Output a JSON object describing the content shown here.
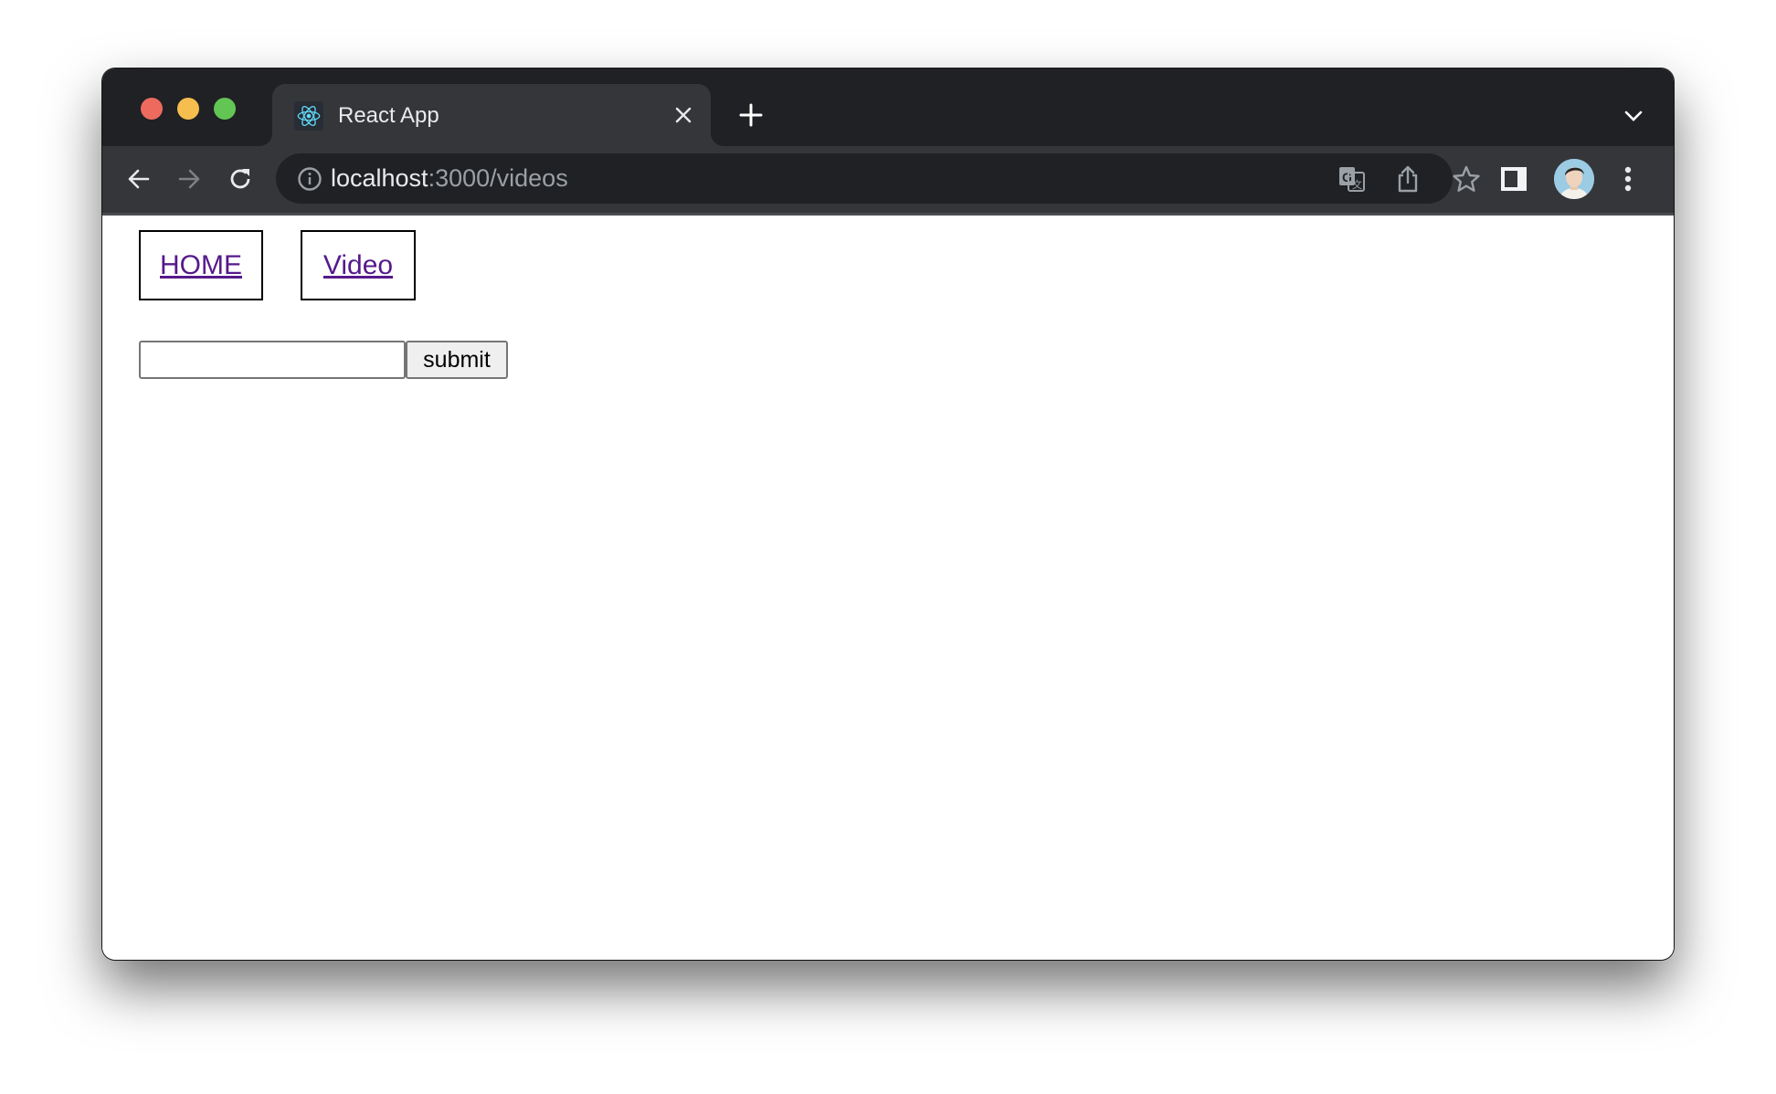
{
  "browser": {
    "tab": {
      "title": "React App",
      "favicon": "react-logo-icon"
    },
    "address_bar": {
      "host": "localhost",
      "path": ":3000/videos"
    },
    "icons": {
      "back": "arrow-left-icon",
      "forward": "arrow-right-icon",
      "reload": "reload-icon",
      "info": "info-icon",
      "translate": "translate-icon",
      "share": "share-icon",
      "bookmark": "star-icon",
      "side_panel": "side-panel-icon",
      "menu": "more-vertical-icon",
      "tab_close": "close-icon",
      "new_tab": "plus-icon",
      "tab_search": "chevron-down-icon"
    }
  },
  "page": {
    "nav": [
      {
        "label": "HOME"
      },
      {
        "label": "Video"
      }
    ],
    "search_input": {
      "value": "",
      "placeholder": ""
    },
    "submit_label": "submit"
  },
  "colors": {
    "link_visited": "#551a8b",
    "tabstrip_bg": "#202124",
    "toolbar_bg": "#35363a"
  }
}
